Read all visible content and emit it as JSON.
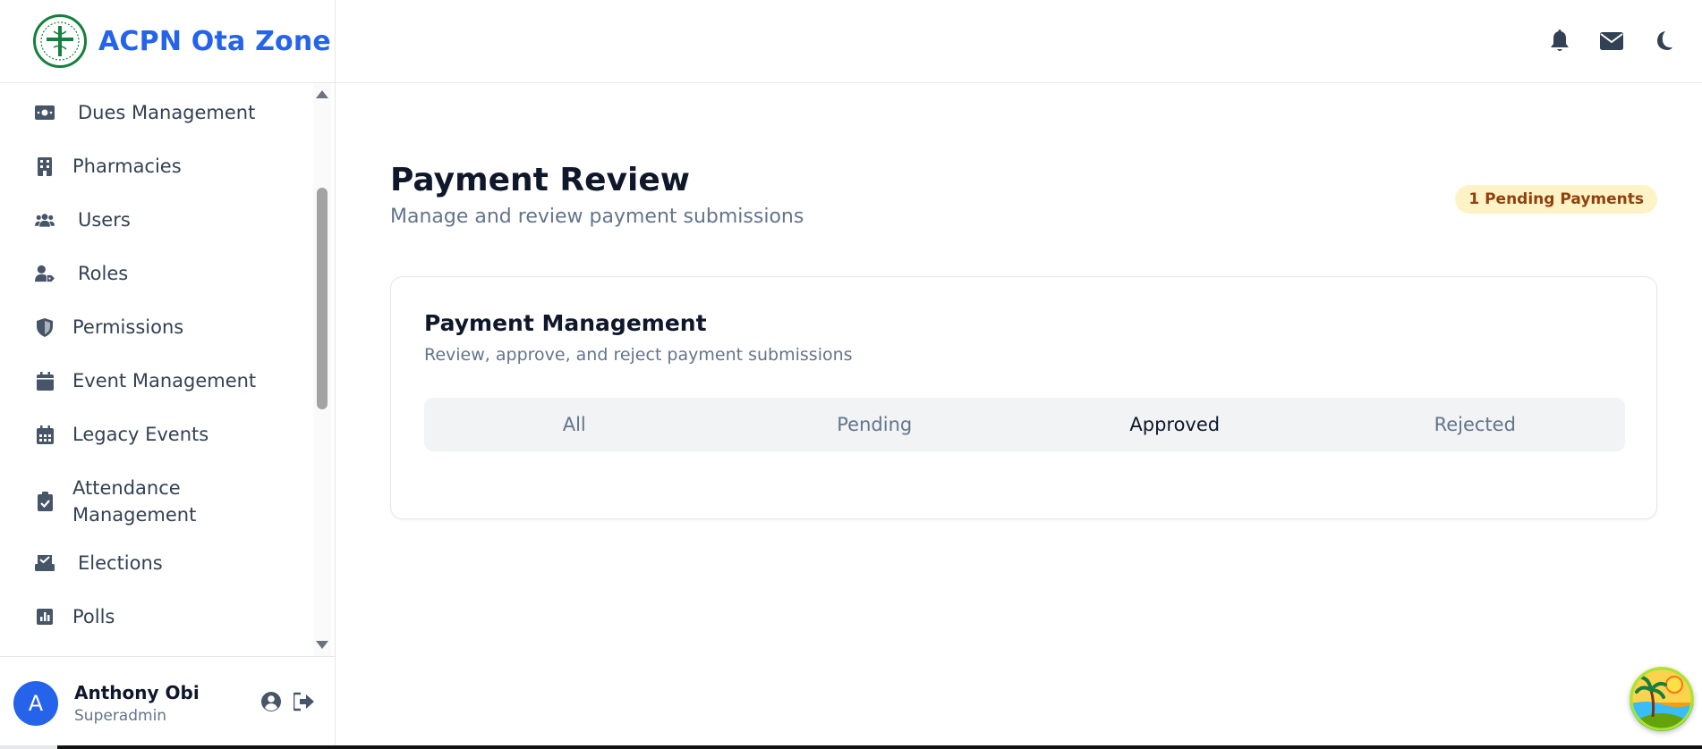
{
  "brand": {
    "title": "ACPN Ota Zone",
    "logo_icon": "pharmacy-cross-logo",
    "accent": "#2563eb"
  },
  "sidebar": {
    "items": [
      {
        "label": "Dues Management",
        "icon": "money-icon"
      },
      {
        "label": "Pharmacies",
        "icon": "building-icon"
      },
      {
        "label": "Users",
        "icon": "users-icon"
      },
      {
        "label": "Roles",
        "icon": "user-tag-icon"
      },
      {
        "label": "Permissions",
        "icon": "shield-icon"
      },
      {
        "label": "Event Management",
        "icon": "calendar-icon"
      },
      {
        "label": "Legacy Events",
        "icon": "calendar-days-icon"
      },
      {
        "label": "Attendance",
        "label2": "Management",
        "icon": "clipboard-check-icon"
      },
      {
        "label": "Elections",
        "icon": "vote-box-icon"
      },
      {
        "label": "Polls",
        "icon": "poll-icon"
      }
    ]
  },
  "user": {
    "initial": "A",
    "name": "Anthony Obi",
    "role": "Superadmin"
  },
  "header": {
    "icons": [
      "bell-icon",
      "envelope-icon",
      "moon-icon"
    ]
  },
  "main": {
    "title": "Payment Review",
    "subtitle": "Manage and review payment submissions",
    "badge": "1 Pending Payments",
    "card": {
      "title": "Payment Management",
      "subtitle": "Review, approve, and reject payment submissions",
      "tabs": [
        "All",
        "Pending",
        "Approved",
        "Rejected"
      ],
      "active_tab": "Approved"
    }
  }
}
